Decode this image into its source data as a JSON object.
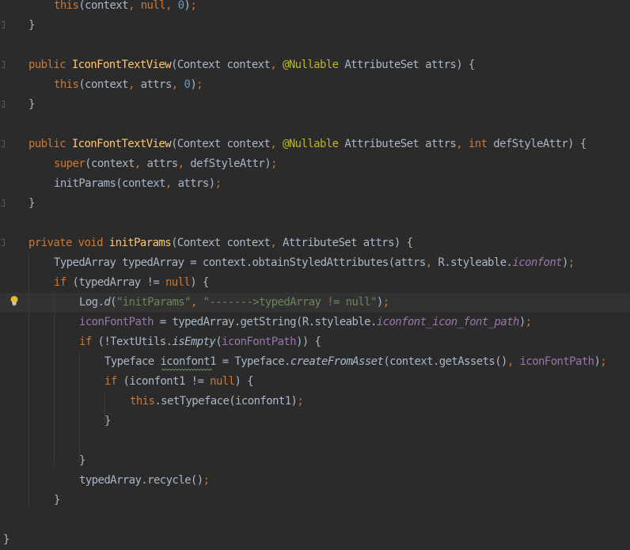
{
  "editor": {
    "background": "#2b2b2b",
    "current_line_bg": "#323232",
    "colors": {
      "keyword": "#cc7832",
      "identifier": "#a9b7c6",
      "method_decl": "#ffc66d",
      "number": "#6897bb",
      "string": "#6a8759",
      "annotation": "#bbb529",
      "field": "#9876aa"
    },
    "gutter_icons": [
      "fold-marker-icon",
      "lightbulb-icon"
    ],
    "lines": [
      {
        "tokens": [
          [
            "kw",
            "this"
          ],
          [
            "id",
            "(context"
          ],
          [
            "punc",
            ", "
          ],
          [
            "kw",
            "null"
          ],
          [
            "punc",
            ", "
          ],
          [
            "num",
            "0"
          ],
          [
            "id",
            ")"
          ],
          [
            "punc",
            ";"
          ]
        ]
      },
      {
        "tokens": [
          [
            "id",
            "}"
          ]
        ]
      },
      {
        "tokens": []
      },
      {
        "tokens": [
          [
            "kw",
            "public "
          ],
          [
            "fn",
            "IconFontTextView"
          ],
          [
            "id",
            "(Context context"
          ],
          [
            "punc",
            ", "
          ],
          [
            "ann",
            "@Nullable "
          ],
          [
            "id",
            "AttributeSet attrs) {"
          ]
        ]
      },
      {
        "tokens": [
          [
            "kw",
            "this"
          ],
          [
            "id",
            "(context"
          ],
          [
            "punc",
            ", "
          ],
          [
            "id",
            "attrs"
          ],
          [
            "punc",
            ", "
          ],
          [
            "num",
            "0"
          ],
          [
            "id",
            ")"
          ],
          [
            "punc",
            ";"
          ]
        ]
      },
      {
        "tokens": [
          [
            "id",
            "}"
          ]
        ]
      },
      {
        "tokens": []
      },
      {
        "tokens": [
          [
            "kw",
            "public "
          ],
          [
            "fn",
            "IconFontTextView"
          ],
          [
            "id",
            "(Context context"
          ],
          [
            "punc",
            ", "
          ],
          [
            "ann",
            "@Nullable "
          ],
          [
            "id",
            "AttributeSet attrs"
          ],
          [
            "punc",
            ", "
          ],
          [
            "kw",
            "int "
          ],
          [
            "id",
            "defStyleAttr) {"
          ]
        ]
      },
      {
        "tokens": [
          [
            "kw",
            "super"
          ],
          [
            "id",
            "(context"
          ],
          [
            "punc",
            ", "
          ],
          [
            "id",
            "attrs"
          ],
          [
            "punc",
            ", "
          ],
          [
            "id",
            "defStyleAttr)"
          ],
          [
            "punc",
            ";"
          ]
        ]
      },
      {
        "tokens": [
          [
            "id",
            "initParams(context"
          ],
          [
            "punc",
            ", "
          ],
          [
            "id",
            "attrs)"
          ],
          [
            "punc",
            ";"
          ]
        ]
      },
      {
        "tokens": [
          [
            "id",
            "}"
          ]
        ]
      },
      {
        "tokens": []
      },
      {
        "tokens": [
          [
            "kw",
            "private void "
          ],
          [
            "fn",
            "initParams"
          ],
          [
            "id",
            "(Context context"
          ],
          [
            "punc",
            ", "
          ],
          [
            "id",
            "AttributeSet attrs) {"
          ]
        ]
      },
      {
        "tokens": [
          [
            "id",
            "TypedArray typedArray = context.obtainStyledAttributes(attrs"
          ],
          [
            "punc",
            ", "
          ],
          [
            "id",
            "R.styleable."
          ],
          [
            "static",
            "iconfont"
          ],
          [
            "id",
            ")"
          ],
          [
            "punc",
            ";"
          ]
        ]
      },
      {
        "tokens": [
          [
            "kw",
            "if "
          ],
          [
            "id",
            "(typedArray != "
          ],
          [
            "kw",
            "null"
          ],
          [
            "id",
            ") {"
          ]
        ]
      },
      {
        "tokens": [
          [
            "id",
            "Log."
          ],
          [
            "sm",
            "d"
          ],
          [
            "id",
            "("
          ],
          [
            "str",
            "\"initParams\""
          ],
          [
            "punc",
            ", "
          ],
          [
            "str",
            "\"------->typedArray != null\""
          ],
          [
            "id",
            ")"
          ],
          [
            "punc",
            ";"
          ]
        ]
      },
      {
        "tokens": [
          [
            "field",
            "iconFontPath"
          ],
          [
            "id",
            " = typedArray.getString(R.styleable."
          ],
          [
            "static",
            "iconfont_icon_font_path"
          ],
          [
            "id",
            ")"
          ],
          [
            "punc",
            ";"
          ]
        ]
      },
      {
        "tokens": [
          [
            "kw",
            "if "
          ],
          [
            "id",
            "(!TextUtils."
          ],
          [
            "sm",
            "isEmpty"
          ],
          [
            "id",
            "("
          ],
          [
            "field",
            "iconFontPath"
          ],
          [
            "id",
            ")) {"
          ]
        ]
      },
      {
        "tokens": [
          [
            "id",
            "Typeface iconfont1 = Typeface."
          ],
          [
            "sm",
            "createFromAsset"
          ],
          [
            "id",
            "(context.getAssets()"
          ],
          [
            "punc",
            ", "
          ],
          [
            "field",
            "iconFontPath"
          ],
          [
            "id",
            ")"
          ],
          [
            "punc",
            ";"
          ]
        ]
      },
      {
        "tokens": [
          [
            "kw",
            "if "
          ],
          [
            "id",
            "(iconfont1 != "
          ],
          [
            "kw",
            "null"
          ],
          [
            "id",
            ") {"
          ]
        ]
      },
      {
        "tokens": [
          [
            "kw",
            "this"
          ],
          [
            "id",
            ".setTypeface(iconfont1)"
          ],
          [
            "punc",
            ";"
          ]
        ]
      },
      {
        "tokens": [
          [
            "id",
            "}"
          ]
        ]
      },
      {
        "tokens": []
      },
      {
        "tokens": [
          [
            "id",
            "}"
          ]
        ]
      },
      {
        "tokens": [
          [
            "id",
            "typedArray.recycle()"
          ],
          [
            "punc",
            ";"
          ]
        ]
      },
      {
        "tokens": [
          [
            "id",
            "}"
          ]
        ]
      },
      {
        "tokens": []
      },
      {
        "tokens": [
          [
            "id",
            "}"
          ]
        ]
      }
    ]
  }
}
